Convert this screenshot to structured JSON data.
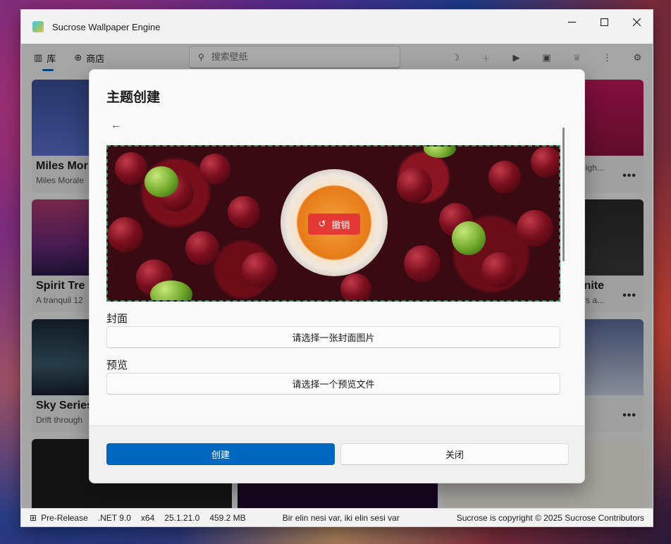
{
  "window": {
    "title": "Sucrose Wallpaper Engine",
    "controls": {
      "minimize": "—",
      "maximize": "☐",
      "close": "✕"
    }
  },
  "nav": {
    "tabs": [
      {
        "label": "库",
        "icon": "library-icon",
        "active": true
      },
      {
        "label": "商店",
        "icon": "store-icon",
        "active": false
      }
    ],
    "search_placeholder": "搜索壁纸",
    "tools": [
      "theme-icon",
      "add-icon",
      "play-icon",
      "display-icon",
      "trophy-icon",
      "more-icon",
      "settings-icon"
    ]
  },
  "library": {
    "cards": [
      {
        "title": "Miles Mor",
        "subtitle": "Miles Morale"
      },
      {
        "title": "Spirit Tre",
        "subtitle": "A tranquil 12"
      },
      {
        "title": "Sky Series",
        "subtitle": "Drift through"
      },
      {
        "title": "",
        "subtitle": "ligh..."
      },
      {
        "title": "nite",
        "subtitle": "rs a..."
      },
      {
        "title": "",
        "subtitle": ""
      }
    ],
    "more_label": "•••"
  },
  "dialog": {
    "title": "主题创建",
    "back_icon": "back-arrow-icon",
    "undo_label": "撤销",
    "cover_label": "封面",
    "cover_button": "请选择一张封面图片",
    "preview_label": "预览",
    "preview_button": "请选择一个预览文件",
    "create_button": "创建",
    "close_button": "关闭"
  },
  "status": {
    "release": "Pre-Release",
    "framework": ".NET 9.0",
    "arch": "x64",
    "version": "25.1.21.0",
    "memory": "459.2 MB",
    "quote": "Bir elin nesi var, iki elin sesi var",
    "copyright": "Sucrose is copyright © 2025 Sucrose Contributors"
  },
  "colors": {
    "accent": "#0067c0",
    "undo": "#e53935",
    "dashed_border": "#3a8a60"
  }
}
